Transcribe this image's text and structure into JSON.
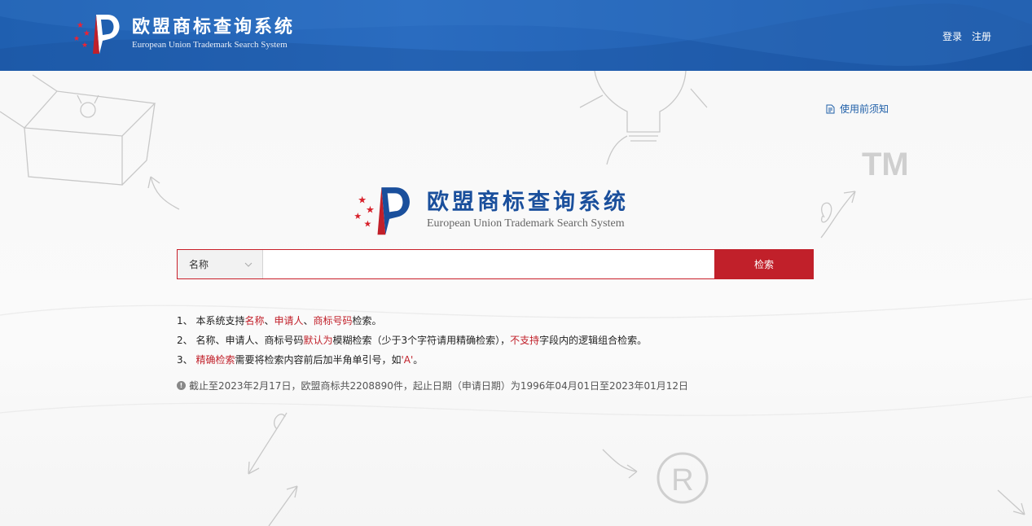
{
  "header": {
    "title_cn": "欧盟商标查询系统",
    "title_en": "European Union Trademark Search System",
    "login": "登录",
    "register": "注册"
  },
  "notice": {
    "label": "使用前须知"
  },
  "center": {
    "title_cn": "欧盟商标查询系统",
    "title_en": "European Union Trademark Search System"
  },
  "search": {
    "field_selected": "名称",
    "input_value": "",
    "button_label": "检索"
  },
  "tips": {
    "line1": [
      "1、 本系统支持",
      "名称",
      "、",
      "申请人",
      "、",
      "商标号码",
      "检索。"
    ],
    "line2": [
      "2、 名称、申请人、商标号码",
      "默认为",
      "模糊检索（少于3个字符请用精确检索），",
      "不支持",
      "字段内的逻辑组合检索。"
    ],
    "line3": [
      "3、 ",
      "精确检索",
      "需要将检索内容前后加半角单引号，如",
      "'A'",
      "。"
    ]
  },
  "stat": {
    "text": "截止至2023年2月17日，欧盟商标共2208890件，起止日期（申请日期）为1996年04月01日至2023年01月12日"
  },
  "decor": {
    "tm_mark": "TM",
    "r_mark": "R"
  },
  "colors": {
    "header_blue": "#2064b4",
    "accent_red": "#c1202a",
    "brand_blue": "#1a4f9c"
  }
}
